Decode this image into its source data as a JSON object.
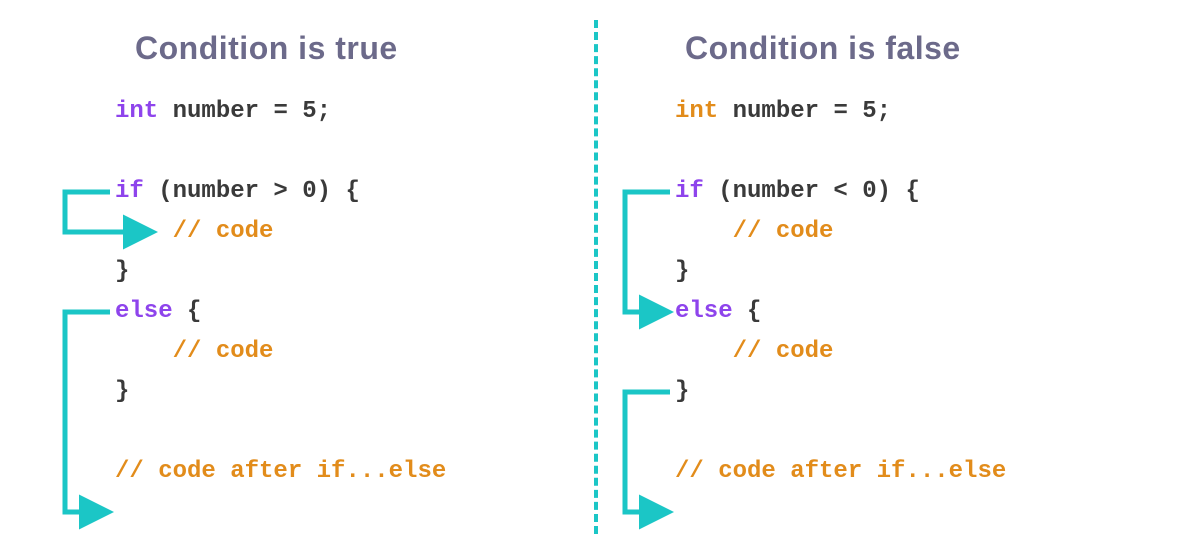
{
  "left": {
    "title": "Condition is true",
    "code": {
      "decl_kw": "int",
      "decl_rest": " number = 5;",
      "if_kw": "if",
      "if_cond": " (number > 0) {",
      "comment_in_if": "// code",
      "close1": "}",
      "else_kw": "else",
      "else_open": " {",
      "comment_in_else": "// code",
      "close2": "}",
      "after": "// code after if...else"
    }
  },
  "right": {
    "title": "Condition is false",
    "code": {
      "decl_kw": "int",
      "decl_rest": " number = 5;",
      "if_kw": "if",
      "if_cond": " (number < 0) {",
      "comment_in_if": "// code",
      "close1": "}",
      "else_kw": "else",
      "else_open": " {",
      "comment_in_else": "// code",
      "close2": "}",
      "after": "// code after if...else"
    }
  },
  "colors": {
    "arrow": "#1bc6c6",
    "title": "#6c6a8a",
    "keyword_purple": "#8e44ec",
    "keyword_orange": "#e28c1b",
    "text": "#3a3a3a"
  }
}
